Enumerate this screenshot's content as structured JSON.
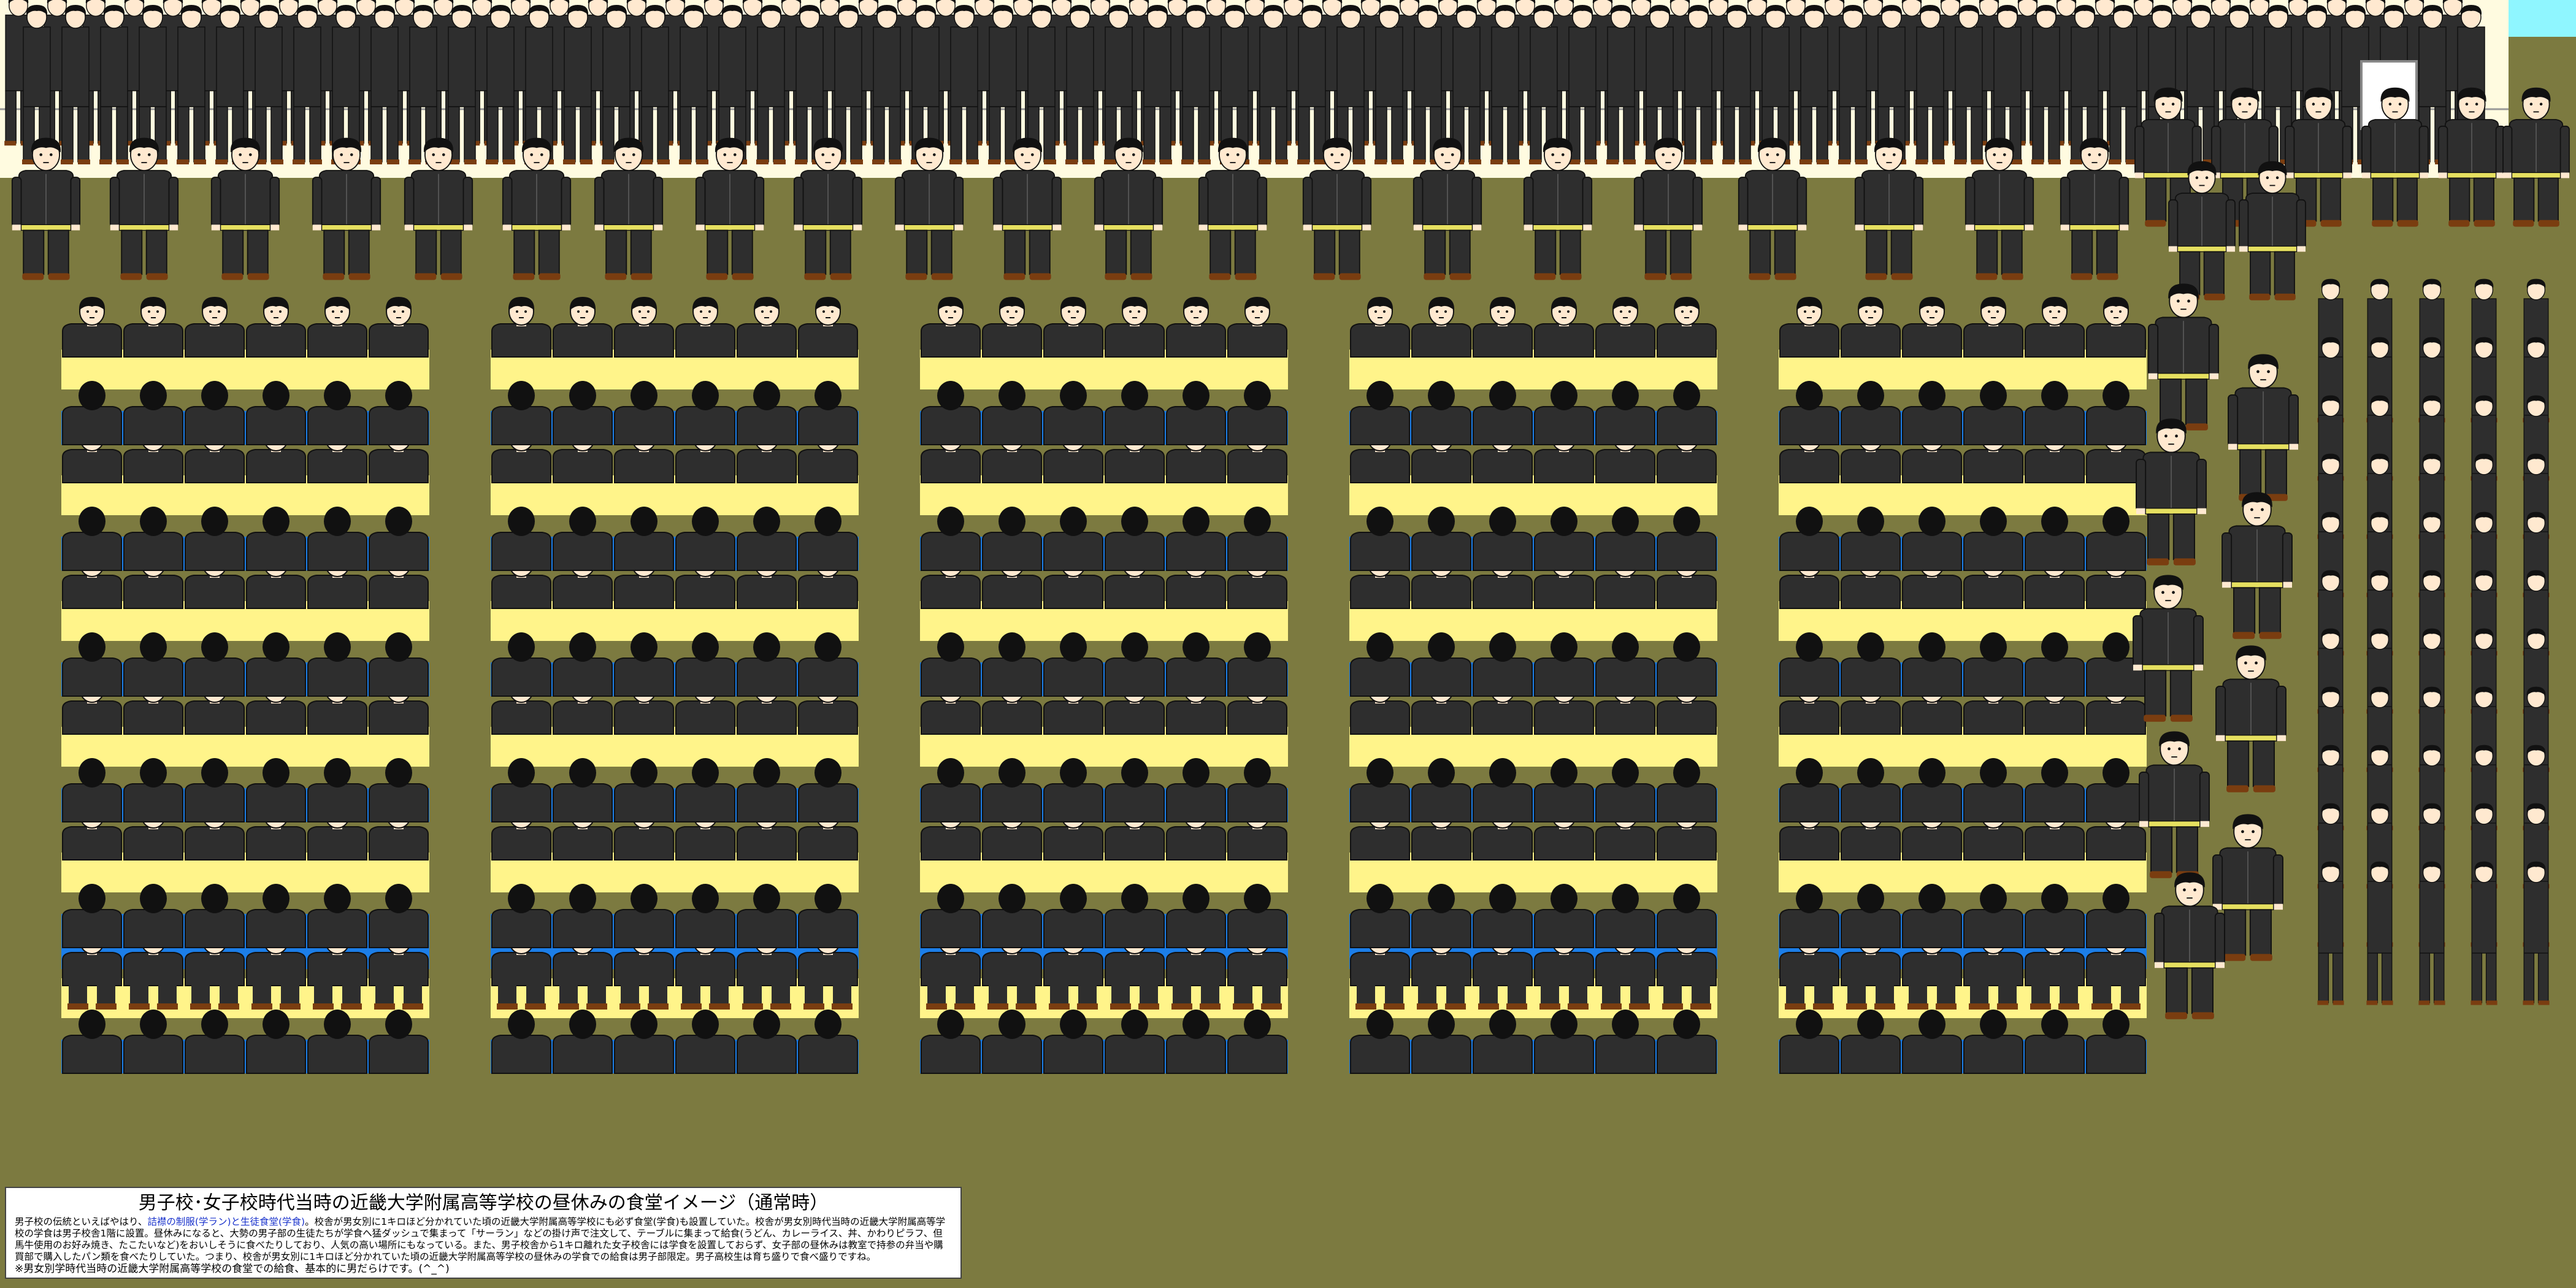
{
  "scene": {
    "colors": {
      "floor": "#7c7a40",
      "sky": "#8ff6ff",
      "uniform": "#2e2e2e",
      "hair": "#111111",
      "skin": "#ffe9d0",
      "table_yellow": "#fff48a",
      "table_blue": "#1c7ee8",
      "belt": "#e6e060",
      "shoe": "#7a3d10"
    },
    "elements": {
      "standing_students": "standing-student-figure",
      "seated_students": "seated-student-figure",
      "dining_tables": "cafeteria-table",
      "door": "cafeteria-door"
    }
  },
  "caption": {
    "title": "男子校･女子校時代当時の近畿大学附属高等学校の昼休みの食堂イメージ（通常時）",
    "body_intro": "男子校の伝統といえばやはり、",
    "body_highlight": "詰襟の制服(学ラン)と生徒食堂(学食)",
    "body_rest": "。校舎が男女別に1キロほど分かれていた頃の近畿大学附属高等学校にも必ず食堂(学食)も設置していた。校舎が男女別時代当時の近畿大学附属高等学校の学食は男子校舎1階に設置。昼休みになると、大勢の男子部の生徒たちが学食へ猛ダッシュで集まって「サーラン」などの掛け声で注文して、テーブルに集まって給食(うどん、カレーライス、丼、かわりピラフ、但馬牛使用のお好み焼き、たこたいなど)をおいしそうに食べたりしており、人気の高い場所にもなっている。また、男子校舎から1キロ離れた女子校舎には学食を設置しておらず、女子部の昼休みは教室で持参の弁当や購買部で購入したパン類を食べたりしていた。つまり、校舎が男女別に1キロほど分かれていた頃の近畿大学附属高等学校の昼休みの学食での給食は男子部限定。男子高校生は育ち盛りで食べ盛りですね。",
    "note": "※男女別学時代当時の近畿大学附属高等学校の食堂での給食、基本的に男だらけです。(^_^)"
  }
}
